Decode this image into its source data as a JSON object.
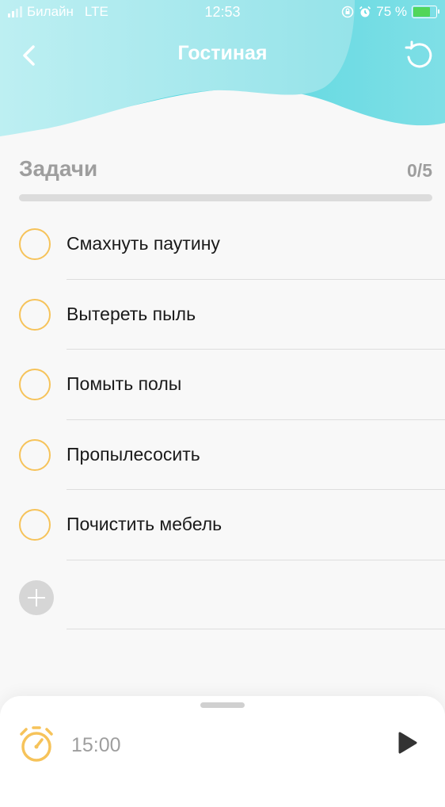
{
  "status_bar": {
    "carrier": "Билайн",
    "network": "LTE",
    "time": "12:53",
    "battery": "75 %"
  },
  "header": {
    "title": "Гостиная",
    "back_icon": "chevron-left-icon",
    "reset_icon": "undo-icon"
  },
  "tasks": {
    "section_title": "Задачи",
    "count": "0/5",
    "progress": 0,
    "items": [
      {
        "label": "Смахнуть паутину",
        "done": false
      },
      {
        "label": "Вытереть пыль",
        "done": false
      },
      {
        "label": "Помыть полы",
        "done": false
      },
      {
        "label": "Пропылесосить",
        "done": false
      },
      {
        "label": "Почистить мебель",
        "done": false
      }
    ],
    "add_icon": "plus-icon"
  },
  "timer": {
    "value": "15:00",
    "icon": "stopwatch-icon",
    "play_icon": "play-icon"
  },
  "colors": {
    "accent": "#f6c35a",
    "header_teal": "#3fd3dc",
    "header_light": "#b8ecef"
  }
}
